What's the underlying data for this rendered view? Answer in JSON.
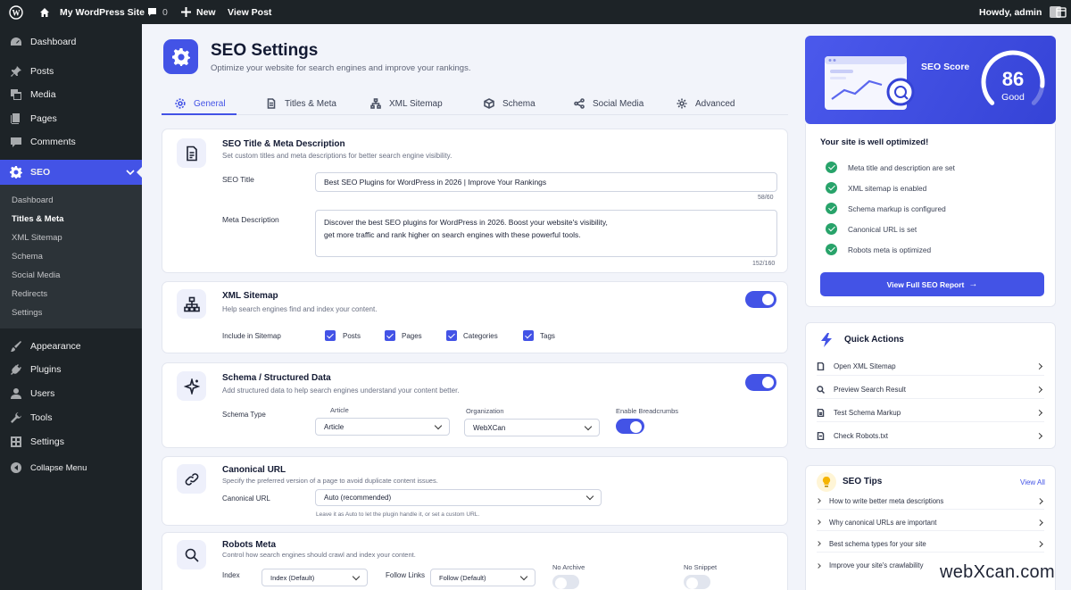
{
  "adminbar": {
    "site_name": "My WordPress Site",
    "comments_count": "0",
    "new_label": "New",
    "view_post_label": "View Post",
    "greeting": "Howdy, admin"
  },
  "sidebar": {
    "items": [
      {
        "label": "Dashboard",
        "icon": "dashboard-icon"
      },
      {
        "label": "Posts",
        "icon": "pin-icon"
      },
      {
        "label": "Media",
        "icon": "media-icon"
      },
      {
        "label": "Pages",
        "icon": "pages-icon"
      },
      {
        "label": "Comments",
        "icon": "comments-icon"
      },
      {
        "label": "SEO",
        "icon": "gear-icon"
      },
      {
        "label": "Appearance",
        "icon": "brush-icon"
      },
      {
        "label": "Plugins",
        "icon": "plug-icon"
      },
      {
        "label": "Users",
        "icon": "users-icon"
      },
      {
        "label": "Tools",
        "icon": "wrench-icon"
      },
      {
        "label": "Settings",
        "icon": "settings-icon"
      },
      {
        "label": "Collapse Menu",
        "icon": "collapse-icon"
      }
    ],
    "submenu": [
      "Dashboard",
      "Titles & Meta",
      "XML Sitemap",
      "Schema",
      "Social Media",
      "Redirects",
      "Settings"
    ]
  },
  "header": {
    "title": "SEO Settings",
    "subtitle": "Optimize your website for search engines and improve your rankings."
  },
  "tabs": [
    "General",
    "Titles & Meta",
    "XML Sitemap",
    "Schema",
    "Social Media",
    "Advanced"
  ],
  "seo_title_card": {
    "title": "SEO Title & Meta Description",
    "subtitle": "Set custom titles and meta descriptions for better search engine visibility.",
    "seo_title_label": "SEO Title",
    "seo_title_value": "Best SEO Plugins for WordPress in 2026 | Improve Your Rankings",
    "seo_title_count": "58/60",
    "meta_label": "Meta Description",
    "meta_line1": "Discover the best SEO plugins for WordPress in 2026. Boost your website's visibility,",
    "meta_line2": "get more traffic and rank higher on search engines with these powerful tools.",
    "meta_count": "152/160"
  },
  "sitemap_card": {
    "title": "XML Sitemap",
    "subtitle": "Help search engines find and index your content.",
    "include_label": "Include in Sitemap",
    "options": [
      "Posts",
      "Pages",
      "Categories",
      "Tags"
    ]
  },
  "schema_card": {
    "title": "Schema / Structured Data",
    "subtitle": "Add structured data to help search engines understand your content better.",
    "type_label": "Schema Type",
    "article_caption": "Article",
    "type_value": "Article",
    "org_label": "Organization",
    "org_value": "WebXCan",
    "breadcrumbs_label": "Enable Breadcrumbs"
  },
  "canonical_card": {
    "title": "Canonical URL",
    "subtitle": "Specify the preferred version of a page to avoid duplicate content issues.",
    "label": "Canonical URL",
    "value": "Auto (recommended)",
    "hint": "Leave it as Auto to let the plugin handle it, or set a custom URL."
  },
  "robots_card": {
    "title": "Robots Meta",
    "subtitle": "Control how search engines should crawl and index your content.",
    "index_label": "Index",
    "index_value": "Index (Default)",
    "follow_label": "Follow Links",
    "follow_value": "Follow (Default)",
    "noarchive_label": "No Archive",
    "nosnippet_label": "No Snippet"
  },
  "score": {
    "label": "SEO Score",
    "value": "86",
    "rating": "Good",
    "level_percent": 86
  },
  "optimized": {
    "title": "Your site is well optimized!",
    "items": [
      "Meta title and description are set",
      "XML sitemap is enabled",
      "Schema markup is configured",
      "Canonical URL is set",
      "Robots meta is optimized"
    ],
    "button": "View Full SEO Report"
  },
  "quick_actions": {
    "title": "Quick Actions",
    "items": [
      "Open XML Sitemap",
      "Preview Search Result",
      "Test Schema Markup",
      "Check Robots.txt"
    ]
  },
  "tips": {
    "title": "SEO Tips",
    "view_all": "View All",
    "items": [
      "How to write better meta descriptions",
      "Why canonical URLs are important",
      "Best schema types for your site",
      "Improve your site's crawlability"
    ]
  },
  "watermark": "webXcan.com",
  "colors": {
    "accent": "#4353e6",
    "sidebar": "#1d2327",
    "success": "#28a36a"
  }
}
